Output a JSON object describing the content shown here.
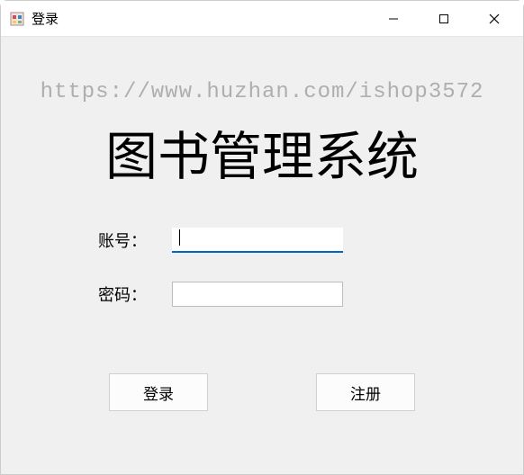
{
  "window": {
    "title": "登录"
  },
  "watermark": "https://www.huzhan.com/ishop3572",
  "heading": "图书管理系统",
  "form": {
    "account_label": "账号：",
    "account_value": "",
    "password_label": "密码：",
    "password_value": ""
  },
  "buttons": {
    "login": "登录",
    "register": "注册"
  }
}
